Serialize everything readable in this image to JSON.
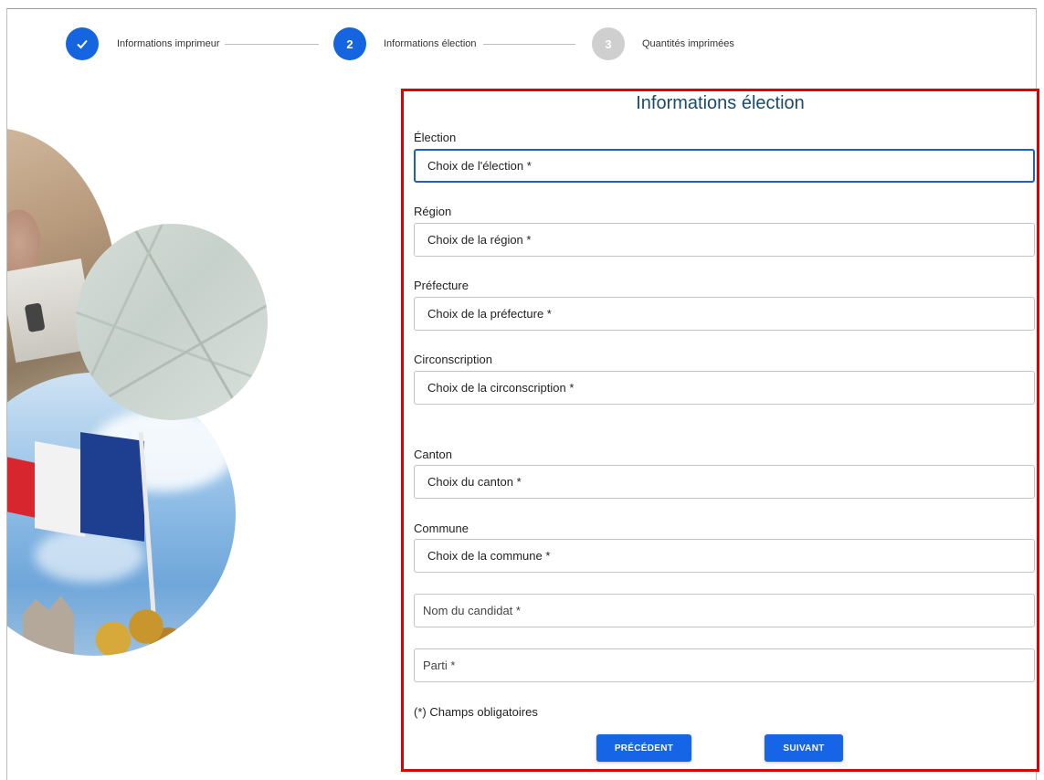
{
  "stepper": {
    "steps": [
      {
        "number": "",
        "label": "Informations imprimeur",
        "state": "done"
      },
      {
        "number": "2",
        "label": "Informations élection",
        "state": "active"
      },
      {
        "number": "3",
        "label": "Quantités imprimées",
        "state": "todo"
      }
    ]
  },
  "form": {
    "title": "Informations élection",
    "election": {
      "label": "Élection",
      "placeholder": "Choix de l'élection *"
    },
    "region": {
      "label": "Région",
      "placeholder": "Choix de la région *"
    },
    "prefecture": {
      "label": "Préfecture",
      "placeholder": "Choix de la préfecture *"
    },
    "circonscription": {
      "label": "Circonscription",
      "placeholder": "Choix de la circonscription *"
    },
    "canton": {
      "label": "Canton",
      "placeholder": "Choix du canton *"
    },
    "commune": {
      "label": "Commune",
      "placeholder": "Choix de la commune *"
    },
    "candidat": {
      "placeholder": "Nom du candidat *"
    },
    "parti": {
      "placeholder": "Parti *"
    },
    "required_note": "(*) Champs obligatoires",
    "prev_label": "PRÉCÉDENT",
    "next_label": "SUIVANT"
  },
  "colors": {
    "primary": "#1665e6",
    "highlight_border": "#e00000",
    "title": "#1a4a6e",
    "step_inactive": "#cfcfcf"
  },
  "icons": {
    "step1": "check-icon"
  }
}
